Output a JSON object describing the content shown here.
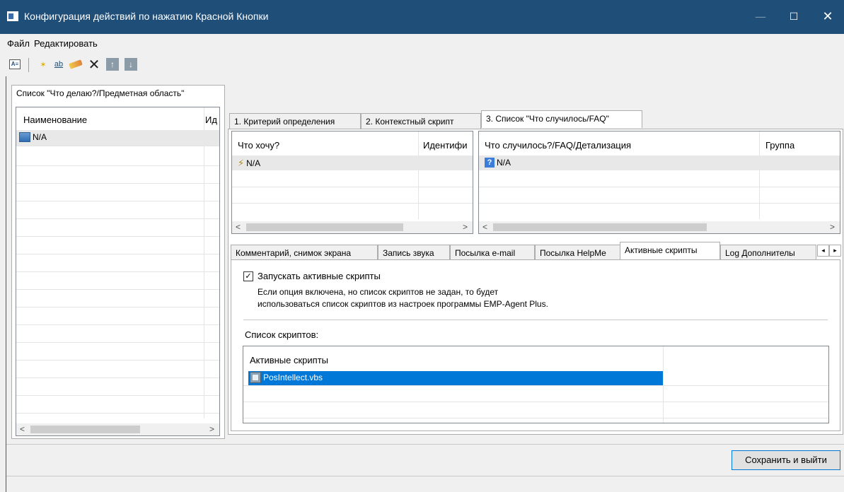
{
  "window": {
    "title": "Конфигурация действий по нажатию Красной Кнопки",
    "min_glyph": "—",
    "max_glyph": "☐",
    "close_glyph": "✕"
  },
  "menu": [
    "Файл",
    "Редактировать"
  ],
  "toolbar": {
    "icons": [
      "properties-icon",
      "new-icon",
      "rename-icon",
      "edit-icon",
      "delete-icon",
      "move-up-icon",
      "move-down-icon"
    ],
    "delete_glyph": "✕",
    "up_glyph": "↑",
    "down_glyph": "↓",
    "rename_glyph": "ab"
  },
  "left": {
    "tab": "Список \"Что делаю?/Предметная область\"",
    "columns": [
      "Наименование",
      "Ид"
    ],
    "rows": [
      {
        "name": "N/A"
      }
    ]
  },
  "right_tabs": [
    "1. Критерий определения",
    "2. Контекстный скрипт",
    "3. Список \"Что случилось/FAQ\""
  ],
  "want_list": {
    "columns": [
      "Что хочу?",
      "Идентифи"
    ],
    "rows": [
      {
        "name": "N/A"
      }
    ]
  },
  "faq_list": {
    "columns": [
      "Что случилось?/FAQ/Детализация",
      "Группа"
    ],
    "rows": [
      {
        "name": "N/A"
      }
    ]
  },
  "bottom_tabs": [
    "Комментарий, снимок экрана",
    "Запись звука",
    "Посылка e-mail",
    "Посылка HelpMe",
    "Активные скрипты",
    "Log Дополнителы"
  ],
  "active_scripts": {
    "checkbox_label": "Запускать активные скрипты",
    "checked": true,
    "check_glyph": "✓",
    "note_line1": "Если опция включена, но список скриптов не задан, то будет",
    "note_line2": "использоваться список скриптов из настроек программы EMP-Agent Plus.",
    "list_label": "Список скриптов:",
    "column": "Активные скрипты",
    "scripts": [
      "PosIntellect.vbs"
    ]
  },
  "scroll": {
    "left": "<",
    "right": ">",
    "tab_prev": "◂",
    "tab_next": "▸"
  },
  "save_button": "Сохранить и выйти",
  "colors": {
    "titlebar": "#1f4e79",
    "selection": "#0078d7"
  }
}
